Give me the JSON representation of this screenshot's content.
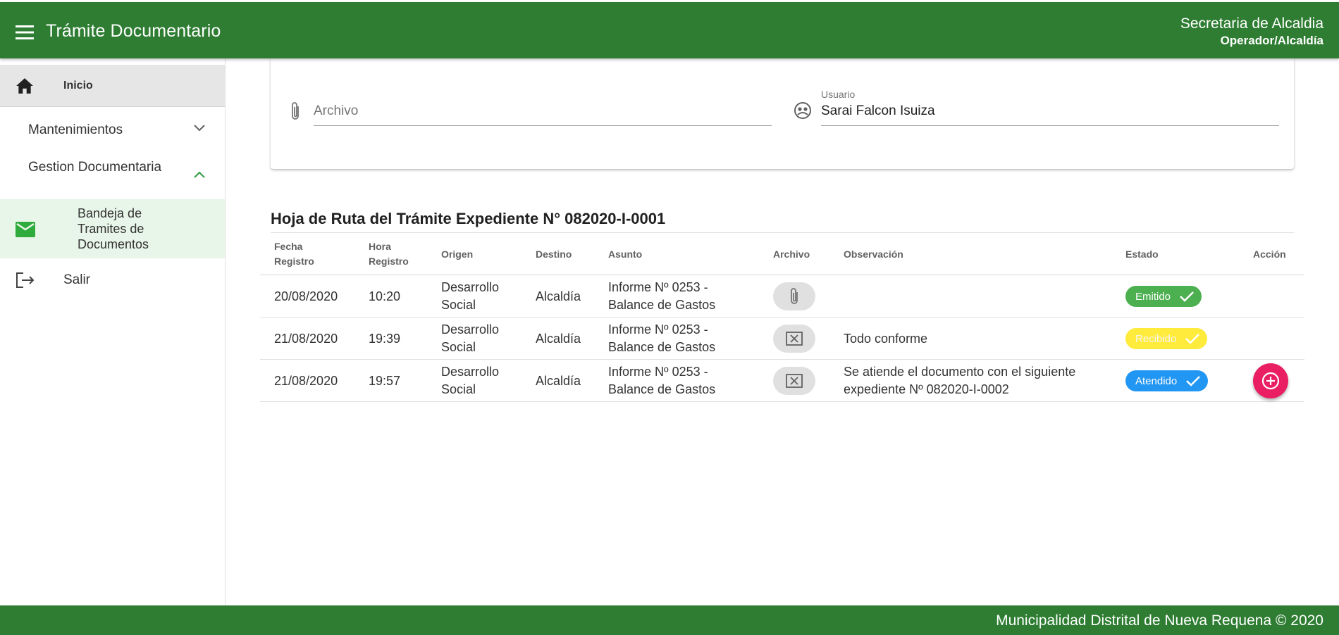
{
  "app": {
    "title": "Trámite Documentario",
    "user_name": "Secretaria de Alcaldia",
    "user_role": "Operador/Alcaldía"
  },
  "sidebar": {
    "items": [
      {
        "label": "Inicio",
        "icon": "home-icon"
      },
      {
        "label": "Mantenimientos",
        "icon": "chevron-down-icon"
      },
      {
        "label": "Gestion Documentaria",
        "icon": "chevron-up-icon"
      },
      {
        "label": "Bandeja de Tramites de Documentos",
        "icon": "mail-icon"
      },
      {
        "label": "Salir",
        "icon": "logout-icon"
      }
    ]
  },
  "form": {
    "archivo_placeholder": "Archivo",
    "usuario_label": "Usuario",
    "usuario_value": "Sarai Falcon Isuiza"
  },
  "route_sheet": {
    "title": "Hoja de Ruta del Trámite Expediente N° 082020-I-0001",
    "columns": {
      "fecha": "Fecha Registro",
      "hora": "Hora Registro",
      "origen": "Origen",
      "destino": "Destino",
      "asunto": "Asunto",
      "archivo": "Archivo",
      "observacion": "Observación",
      "estado": "Estado",
      "accion": "Acción"
    },
    "rows": [
      {
        "fecha": "20/08/2020",
        "hora": "10:20",
        "origen": "Desarrollo Social",
        "destino": "Alcaldía",
        "asunto": "Informe Nº 0253 - Balance de Gastos",
        "archivo_icon": "paperclip-icon",
        "observacion": "",
        "estado": "Emitido",
        "estado_color": "#4caf50"
      },
      {
        "fecha": "21/08/2020",
        "hora": "19:39",
        "origen": "Desarrollo Social",
        "destino": "Alcaldía",
        "asunto": "Informe Nº 0253 - Balance de Gastos",
        "archivo_icon": "no-file-icon",
        "observacion": "Todo conforme",
        "estado": "Recibido",
        "estado_color": "#ffeb3b"
      },
      {
        "fecha": "21/08/2020",
        "hora": "19:57",
        "origen": "Desarrollo Social",
        "destino": "Alcaldía",
        "asunto": "Informe Nº 0253 - Balance de Gastos",
        "archivo_icon": "no-file-icon",
        "observacion": "Se atiende el documento con el siguiente expediente Nº 082020-I-0002",
        "estado": "Atendido",
        "estado_color": "#2196f3",
        "accion_icon": "add-circle-icon"
      }
    ]
  },
  "footer": {
    "text": "Municipalidad Distrital de Nueva Requena © 2020"
  },
  "colors": {
    "primary": "#2e7d32",
    "accent": "#e91e63",
    "active_bg": "#e8f5e9"
  }
}
